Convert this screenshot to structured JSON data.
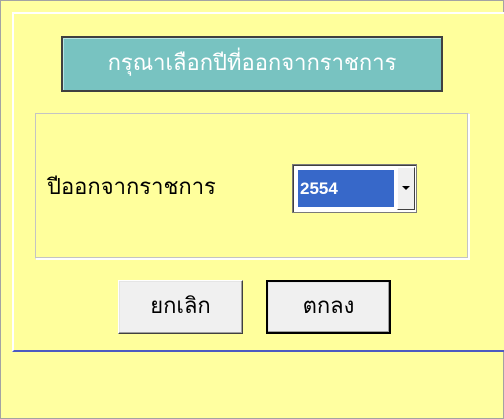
{
  "dialog": {
    "title": "กรุณาเลือกปีที่ออกจากราชการ",
    "year_label": "ปีออกจากราชการ",
    "year_select": {
      "selected": "2554"
    },
    "cancel_label": "ยกเลิก",
    "ok_label": "ตกลง"
  },
  "colors": {
    "background": "#ffffa0",
    "title_bg": "#78c3c1",
    "selection": "#3768c9",
    "panel_border": "#4c5bc1"
  }
}
